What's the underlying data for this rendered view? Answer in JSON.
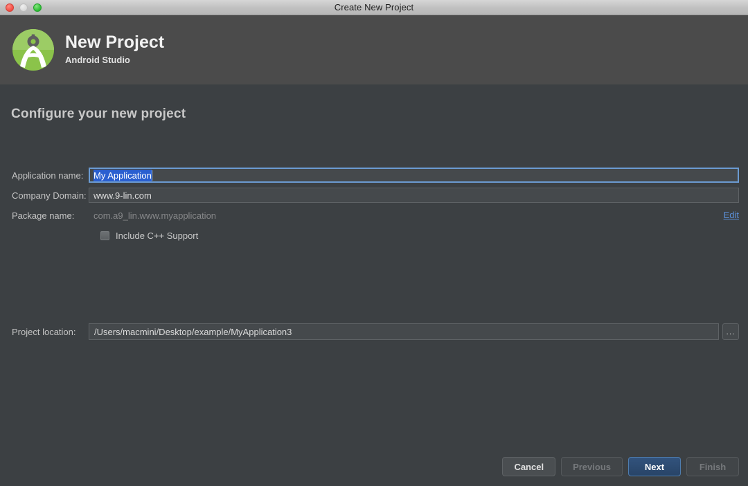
{
  "titlebar": {
    "title": "Create New Project",
    "buttons": [
      {
        "name": "close-button",
        "color": "#f24d44"
      },
      {
        "name": "minimize-button",
        "color": "#d9d9d9"
      },
      {
        "name": "zoom-button",
        "color": "#2bbd33"
      }
    ]
  },
  "header": {
    "logo_icon": "android-studio-logo-icon",
    "title": "New Project",
    "subtitle": "Android Studio"
  },
  "main": {
    "heading": "Configure your new project",
    "fields": {
      "application_name": {
        "label": "Application name:",
        "value": "My Application",
        "selected": true,
        "focused": true
      },
      "company_domain": {
        "label": "Company Domain:",
        "value": "www.9-lin.com",
        "focused": false
      },
      "package_name": {
        "label": "Package name:",
        "value": "com.a9_lin.www.myapplication",
        "editable": false,
        "edit_link": "Edit"
      },
      "include_cpp": {
        "label": "Include C++ Support",
        "checked": false
      },
      "project_location": {
        "label": "Project location:",
        "value": "/Users/macmini/Desktop/example/MyApplication3",
        "browse_label": "..."
      }
    }
  },
  "footer": {
    "buttons": [
      {
        "label": "Cancel",
        "state": "enabled"
      },
      {
        "label": "Previous",
        "state": "disabled"
      },
      {
        "label": "Next",
        "state": "default"
      },
      {
        "label": "Finish",
        "state": "disabled"
      }
    ]
  },
  "colors": {
    "titlebar_bg": "#c0c0c0",
    "header_bg": "#4b4b4b",
    "body_bg": "#3c4043",
    "field_bg": "#45494c",
    "focus_border": "#6b9bd2",
    "selection_blue": "#2a5fd0",
    "link_blue": "#5b8ed6",
    "primary_button": "#2c4a72",
    "logo_green": "#76b743"
  }
}
